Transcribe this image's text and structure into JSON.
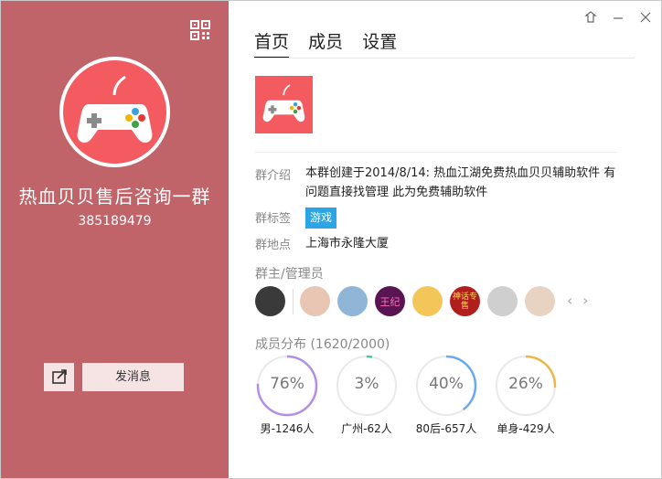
{
  "left": {
    "group_name": "热血贝贝售后咨询一群",
    "group_id": "385189479",
    "send_label": "发消息"
  },
  "tabs": [
    {
      "label": "首页",
      "active": true
    },
    {
      "label": "成员",
      "active": false
    },
    {
      "label": "设置",
      "active": false
    }
  ],
  "info": {
    "intro_label": "群介绍",
    "intro_value": "本群创建于2014/8/14:  热血江湖免费热血贝贝辅助软件  有问题直接找管理 此为免费辅助软件",
    "tag_label": "群标签",
    "tag_value": "游戏",
    "location_label": "群地点",
    "location_value": "上海市永隆大厦"
  },
  "admins": {
    "title": "群主/管理员",
    "avatars": [
      {
        "name": "admin-avatar-1",
        "color": "#3a3a3a"
      },
      {
        "name": "admin-avatar-2",
        "color": "#e9c5b3"
      },
      {
        "name": "admin-avatar-3",
        "color": "#8fb6d6"
      },
      {
        "name": "admin-avatar-4",
        "color": "#5a1452",
        "text": "王纪"
      },
      {
        "name": "admin-avatar-5",
        "color": "#f3c65a"
      },
      {
        "name": "admin-avatar-6",
        "color": "#b01e1e",
        "text": "神话专售"
      },
      {
        "name": "admin-avatar-7",
        "color": "#cfcfcf"
      },
      {
        "name": "admin-avatar-8",
        "color": "#e8d2c2"
      }
    ]
  },
  "members": {
    "title": "成员分布 (1620/2000)",
    "stats": [
      {
        "pct_label": "76%",
        "pct": 76,
        "label": "男-1246人",
        "color": "#b48ee6"
      },
      {
        "pct_label": "3%",
        "pct": 3,
        "label": "广州-62人",
        "color": "#47c3a8"
      },
      {
        "pct_label": "40%",
        "pct": 40,
        "label": "80后-657人",
        "color": "#6aa9ea"
      },
      {
        "pct_label": "26%",
        "pct": 26,
        "label": "单身-429人",
        "color": "#f3b447"
      }
    ]
  },
  "colors": {
    "left_bg": "#c0646a",
    "thumb_bg": "#f35b61",
    "tag_bg": "#2aa6e6"
  }
}
